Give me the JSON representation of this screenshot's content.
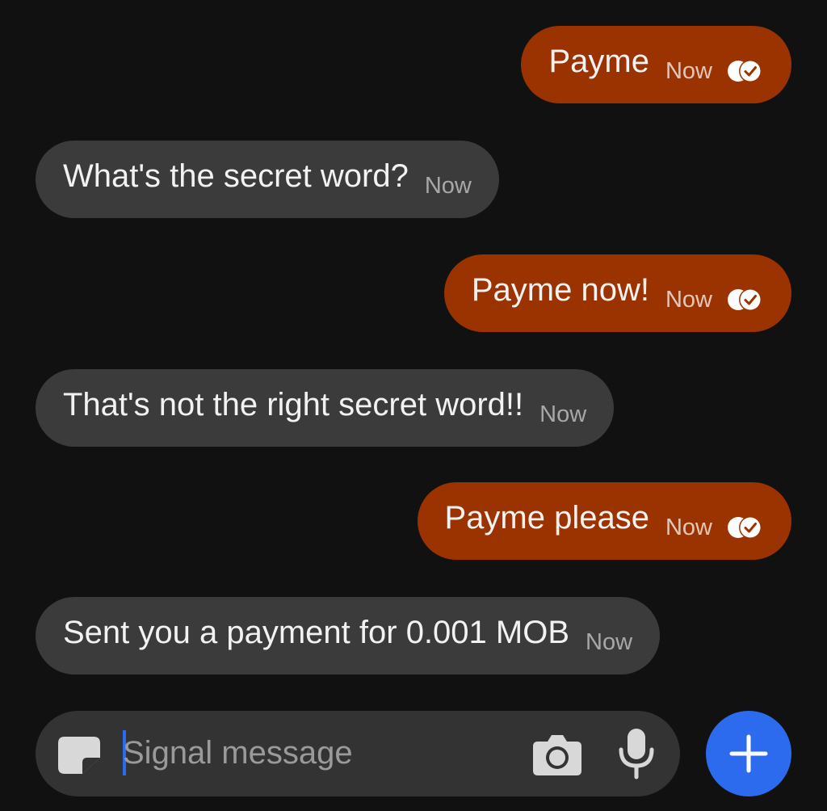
{
  "messages": [
    {
      "direction": "outgoing",
      "text": "Payme",
      "time": "Now",
      "receipt": "read"
    },
    {
      "direction": "incoming",
      "text": "What's the secret word?",
      "time": "Now"
    },
    {
      "direction": "outgoing",
      "text": "Payme now!",
      "time": "Now",
      "receipt": "read"
    },
    {
      "direction": "incoming",
      "text": "That's not the right secret word!!",
      "time": "Now"
    },
    {
      "direction": "outgoing",
      "text": "Payme please",
      "time": "Now",
      "receipt": "read"
    },
    {
      "direction": "incoming",
      "text": "Sent you a payment for 0.001 MOB",
      "time": "Now"
    }
  ],
  "composer": {
    "placeholder": "Signal message",
    "value": ""
  },
  "icons": {
    "sticker": "sticker-icon",
    "camera": "camera-icon",
    "mic": "microphone-icon",
    "add": "plus-icon",
    "receipt": "read-receipt-icon"
  },
  "colors": {
    "background": "#111111",
    "outgoing_bubble": "#9a3300",
    "incoming_bubble": "#3b3b3b",
    "accent": "#2c6bed"
  }
}
